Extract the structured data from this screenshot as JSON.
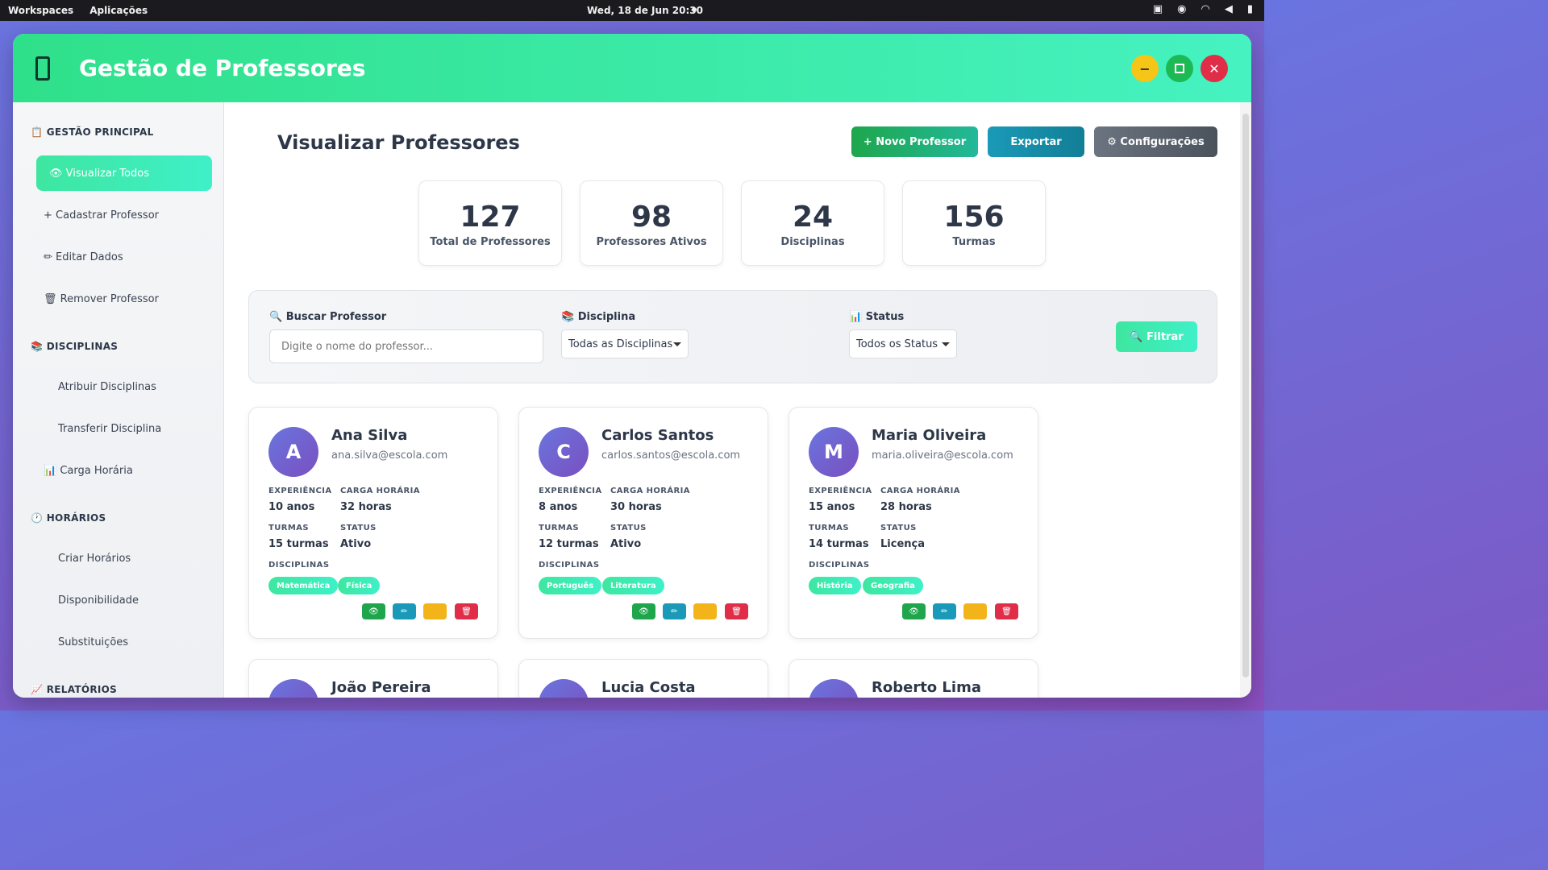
{
  "system_bar": {
    "workspaces": "Workspaces",
    "apps": "Aplicações",
    "clock": "Wed, 18 de Jun  20:30"
  },
  "window": {
    "title": "Gestão de Professores"
  },
  "sidebar": {
    "sections": [
      {
        "label": "📋 GESTÃO PRINCIPAL"
      },
      {
        "label": "📚 DISCIPLINAS"
      },
      {
        "label": "🕐 HORÁRIOS"
      },
      {
        "label": "📈 RELATÓRIOS"
      }
    ],
    "items": [
      {
        "label": "👁 Visualizar Todos"
      },
      {
        "label": "+ Cadastrar Professor"
      },
      {
        "label": "✏ Editar Dados"
      },
      {
        "label": "🗑 Remover Professor"
      },
      {
        "label": "Atribuir Disciplinas"
      },
      {
        "label": "Transferir Disciplina"
      },
      {
        "label": "📊 Carga Horária"
      },
      {
        "label": "Criar Horários"
      },
      {
        "label": "Disponibilidade"
      },
      {
        "label": "Substituições"
      }
    ]
  },
  "main": {
    "title": "Visualizar Professores",
    "buttons": {
      "novo": "+ Novo Professor",
      "exportar": "Exportar",
      "config": "⚙ Configurações"
    },
    "stats": [
      {
        "value": "127",
        "label": "Total de Professores"
      },
      {
        "value": "98",
        "label": "Professores Ativos"
      },
      {
        "value": "24",
        "label": "Disciplinas"
      },
      {
        "value": "156",
        "label": "Turmas"
      }
    ],
    "filters": {
      "search_label": "🔍 Buscar Professor",
      "search_placeholder": "Digite o nome do professor...",
      "disciplina_label": "📚 Disciplina",
      "disciplina_value": "Todas as Disciplinas",
      "status_label": "📊 Status",
      "status_value": "Todos os Status",
      "filter_button": "🔍 Filtrar"
    },
    "field_labels": {
      "experiencia": "EXPERIÊNCIA",
      "carga": "CARGA HORÁRIA",
      "turmas": "TURMAS",
      "status": "STATUS",
      "disciplinas": "DISCIPLINAS"
    },
    "action_icons": {
      "view": "👁",
      "edit": "✏",
      "delete": "🗑"
    },
    "teachers": [
      {
        "initial": "A",
        "name": "Ana Silva",
        "email": "ana.silva@escola.com",
        "experiencia": "10 anos",
        "carga": "32 horas",
        "turmas": "15 turmas",
        "status": "Ativo",
        "disciplinas": [
          "Matemática",
          "Física"
        ]
      },
      {
        "initial": "C",
        "name": "Carlos Santos",
        "email": "carlos.santos@escola.com",
        "experiencia": "8 anos",
        "carga": "30 horas",
        "turmas": "12 turmas",
        "status": "Ativo",
        "disciplinas": [
          "Português",
          "Literatura"
        ]
      },
      {
        "initial": "M",
        "name": "Maria Oliveira",
        "email": "maria.oliveira@escola.com",
        "experiencia": "15 anos",
        "carga": "28 horas",
        "turmas": "14 turmas",
        "status": "Licença",
        "disciplinas": [
          "História",
          "Geografia"
        ]
      },
      {
        "name": "João Pereira"
      },
      {
        "name": "Lucia Costa"
      },
      {
        "name": "Roberto Lima"
      }
    ]
  }
}
